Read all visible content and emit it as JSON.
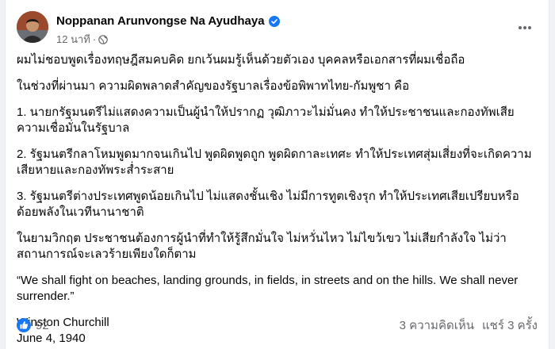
{
  "post": {
    "author": "Noppanan Arunvongse Na Ayudhaya",
    "time": "12 นาที",
    "dot": "·",
    "icons": {
      "avatar": "profile-photo",
      "verified": "verified-badge-icon",
      "privacy": "globe-icon",
      "menu": "more-options-icon",
      "reaction": "like-icon"
    },
    "paragraphs": [
      "ผมไม่ชอบพูดเรื่องทฤษฎีสมคบคิด ยกเว้นผมรู้เห็นด้วยตัวเอง บุคคลหรือเอกสารที่ผมเชื่อถือ",
      "ในช่วงที่ผ่านมา ความผิดพลาดสำคัญของรัฐบาลเรื่องข้อพิพาทไทย-กัมพูชา คือ",
      "1. นายกรัฐมนตรีไม่แสดงความเป็นผู้นำให้ปรากฏ วุฒิภาวะไม่มั่นคง ทำให้ประชาชนและกองทัพเสียความเชื่อมั่นในรัฐบาล",
      "2. รัฐมนตรีกลาโหมพูดมากจนเกินไป พูดผิดพูดถูก พูดผิดกาละเทศะ ทำให้ประเทศสุ่มเสี่ยงที่จะเกิดความเสียหายและกองทัพระส่ำระสาย",
      "3. รัฐมนตรีต่างประเทศพูดน้อยเกินไป ไม่แสดงชั้นเชิง ไม่มีการทูตเชิงรุก ทำให้ประเทศเสียเปรียบหรือด้อยพลังในเวทีนานาชาติ",
      "ในยามวิกฤต ประชาชนต้องการผู้นำที่ทำให้รู้สึกมั่นใจ ไม่หวั่นไหว ไม่ไขว้เขว ไม่เสียกำลังใจ ไม่ว่าสถานการณ์จะเลวร้ายเพียงใดก็ตาม",
      "“We shall fight on beaches, landing grounds, in fields, in streets and on the hills. We shall never surrender.”"
    ],
    "quote_author": "Winston Churchill",
    "quote_date": "June 4, 1940",
    "reactions": "92",
    "comments": "3 ความคิดเห็น",
    "shares": "แชร์ 3 ครั้ง",
    "colors": {
      "verified": "#1877f2",
      "like": "#1877f2",
      "meta": "#65676b"
    }
  }
}
